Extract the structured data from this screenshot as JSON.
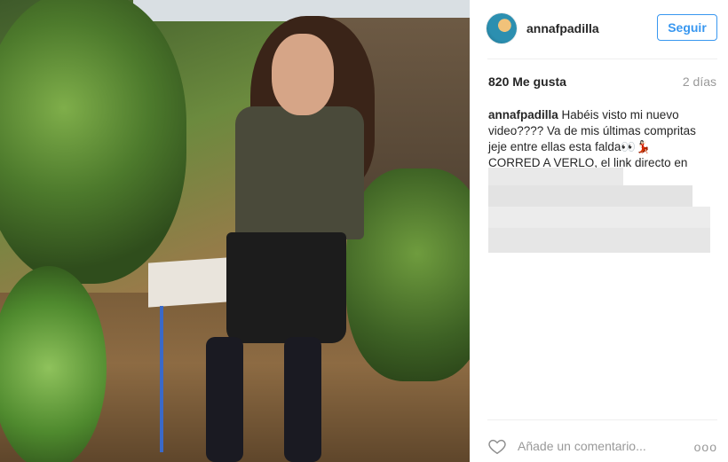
{
  "post": {
    "username": "annafpadilla",
    "follow_label": "Seguir",
    "likes": "820 Me gusta",
    "time": "2 días",
    "caption_author": "annafpadilla",
    "caption_text": " Habéis visto mi nuevo video???? Va de mis últimas compritas jeje entre ellas esta falda👀💃🏻 CORRED A VERLO, el link directo en mi perfil.",
    "comment_placeholder": "Añade un comentario...",
    "more_label": "ooo"
  },
  "colors": {
    "accent": "#3897f0",
    "text": "#262626",
    "muted": "#999999"
  },
  "icons": {
    "like": "heart-outline-icon",
    "more": "more-dots-icon"
  }
}
